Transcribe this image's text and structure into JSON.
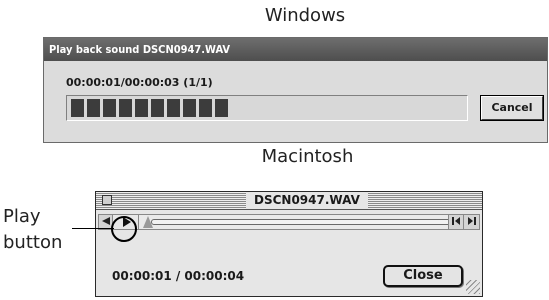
{
  "headings": {
    "windows": "Windows",
    "macintosh": "Macintosh"
  },
  "windows_dialog": {
    "title": "Play back sound DSCN0947.WAV",
    "timecode": "00:00:01/00:00:03 (1/1)",
    "progress_fraction": 0.4,
    "cancel_label": "Cancel"
  },
  "mac_window": {
    "title": "DSCN0947.WAV",
    "time": "00:00:01 / 00:00:04",
    "close_label": "Close",
    "icons": {
      "play": "play-icon",
      "rewind": "rewind-icon",
      "step_back": "step-back-icon",
      "step_forward": "step-forward-icon"
    }
  },
  "callout": {
    "line1": "Play",
    "line2": "button"
  }
}
